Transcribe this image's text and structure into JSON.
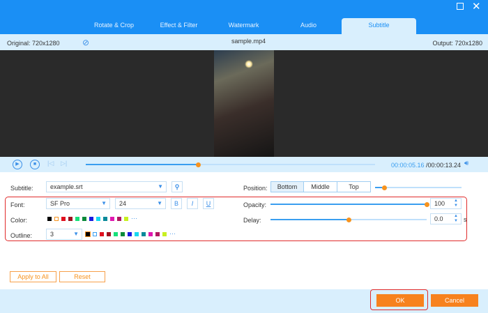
{
  "window": {
    "maximize_icon": "square-icon",
    "close_icon": "x-icon"
  },
  "tabs": [
    {
      "label": "Rotate & Crop"
    },
    {
      "label": "Effect & Filter"
    },
    {
      "label": "Watermark"
    },
    {
      "label": "Audio"
    },
    {
      "label": "Subtitle",
      "active": true
    }
  ],
  "info": {
    "original": "Original: 720x1280",
    "filename": "sample.mp4",
    "output": "Output: 720x1280"
  },
  "player": {
    "current": "00:00:05.16",
    "total": "/00:00:13.24",
    "progress": 0.39
  },
  "subtitle": {
    "label": "Subtitle:",
    "file": "example.srt"
  },
  "position": {
    "label": "Position:",
    "options": [
      "Bottom",
      "Middle",
      "Top"
    ],
    "selected": "Bottom",
    "slider": 0.05
  },
  "font": {
    "label": "Font:",
    "family": "SF Pro",
    "size": "24",
    "bold": "B",
    "italic": "I",
    "underline": "U"
  },
  "opacity": {
    "label": "Opacity:",
    "value": "100",
    "fraction": 1.0
  },
  "color": {
    "label": "Color:",
    "swatches": [
      "#000000",
      "#ffffff",
      "#e0101e",
      "#a0101e",
      "#18e07a",
      "#0a8a3a",
      "#1a1ae0",
      "#18d8f0",
      "#0a8a9a",
      "#e018b0",
      "#b01860",
      "#c8f020"
    ],
    "more": "···"
  },
  "delay": {
    "label": "Delay:",
    "value": "0.0",
    "unit": "s",
    "fraction": 0.5
  },
  "outline": {
    "label": "Outline:",
    "value": "3",
    "more": "···"
  },
  "buttons": {
    "apply_all": "Apply to All",
    "reset": "Reset",
    "ok": "OK",
    "cancel": "Cancel"
  },
  "colors": {
    "accent": "#1a8ff5",
    "orange": "#f7821e",
    "highlight": "#e02b2b"
  }
}
